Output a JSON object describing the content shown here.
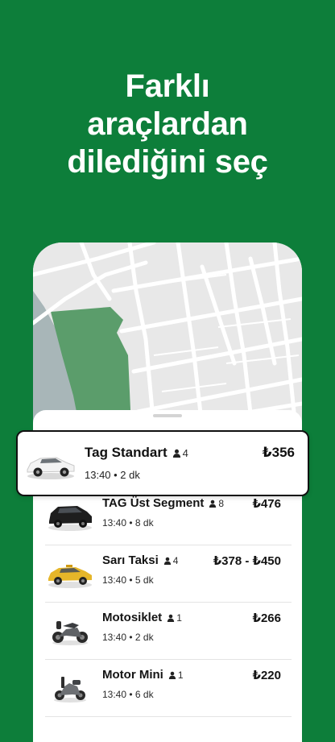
{
  "headline": {
    "line1": "Farklı",
    "line2": "araçlardan",
    "line3": "dilediğini seç"
  },
  "selected_option": {
    "name": "Tag Standart",
    "capacity": "4",
    "price": "₺356",
    "time": "13:40 • 2 dk",
    "icon": "white-sedan-icon"
  },
  "options": [
    {
      "name": "TAG Üst Segment",
      "capacity": "8",
      "price": "₺476",
      "time": "13:40 • 8 dk",
      "icon": "black-suv-icon"
    },
    {
      "name": "Sarı Taksi",
      "capacity": "4",
      "price": "₺378 - ₺450",
      "time": "13:40 • 5 dk",
      "icon": "yellow-taxi-icon"
    },
    {
      "name": "Motosiklet",
      "capacity": "1",
      "price": "₺266",
      "time": "13:40 • 2 dk",
      "icon": "motorcycle-icon"
    },
    {
      "name": "Motor Mini",
      "capacity": "1",
      "price": "₺220",
      "time": "13:40 • 6 dk",
      "icon": "scooter-icon"
    }
  ],
  "colors": {
    "brand_green": "#0d7e3a",
    "map_road": "#ffffff",
    "map_block": "#e8e8e8",
    "map_park": "#5b9d6b",
    "map_water": "#a8b6b8"
  }
}
